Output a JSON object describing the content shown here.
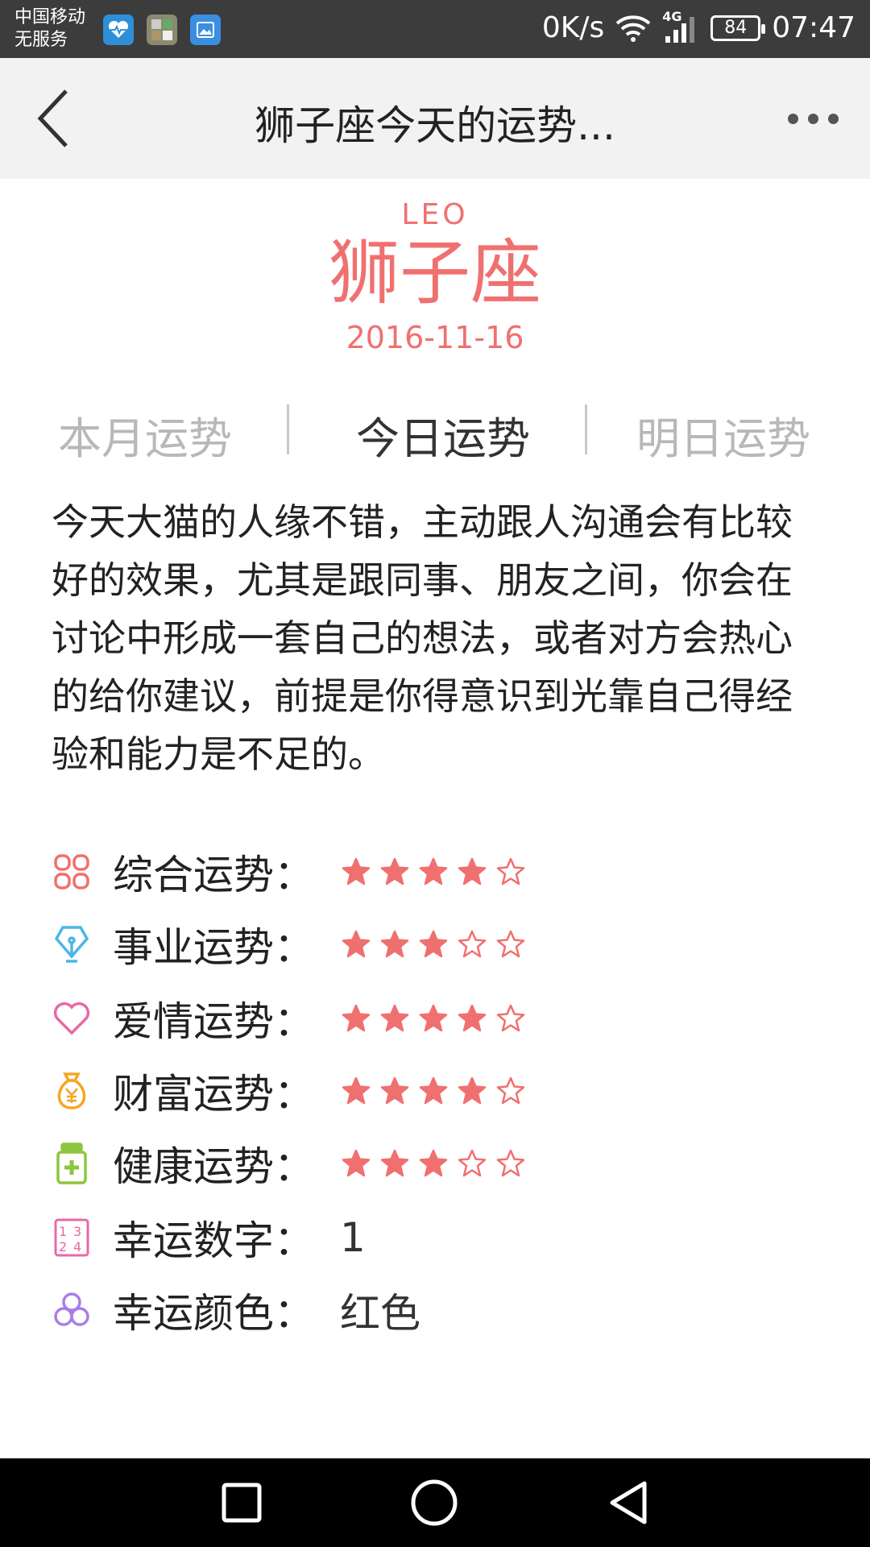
{
  "status_bar": {
    "carrier_line1": "中国移动",
    "carrier_line2": "无服务",
    "net_speed": "0K/s",
    "network_type": "4G",
    "battery": "84",
    "time": "07:47"
  },
  "app_bar": {
    "title": "狮子座今天的运势..."
  },
  "header": {
    "sign_latin": "LEO",
    "sign_name": "狮子座",
    "date": "2016-11-16",
    "accent_color": "#f07070"
  },
  "tabs": [
    {
      "label": "本月运势",
      "active": false
    },
    {
      "label": "今日运势",
      "active": true
    },
    {
      "label": "明日运势",
      "active": false
    }
  ],
  "description": "今天大猫的人缘不错，主动跟人沟通会有比较好的效果，尤其是跟同事、朋友之间，你会在讨论中形成一套自己的想法，或者对方会热心的给你建议，前提是你得意识到光靠自己得经验和能力是不足的。",
  "fortunes": [
    {
      "label": "综合运势：",
      "icon": "clover-icon",
      "icon_color": "#f07070",
      "stars": 4,
      "max": 5
    },
    {
      "label": "事业运势：",
      "icon": "pen-nib-icon",
      "icon_color": "#4ab6e8",
      "stars": 3,
      "max": 5
    },
    {
      "label": "爱情运势：",
      "icon": "heart-icon",
      "icon_color": "#e868a8",
      "stars": 4,
      "max": 5
    },
    {
      "label": "财富运势：",
      "icon": "money-bag-icon",
      "icon_color": "#f5a623",
      "stars": 4,
      "max": 5
    },
    {
      "label": "健康运势：",
      "icon": "medicine-bottle-icon",
      "icon_color": "#8cc63e",
      "stars": 3,
      "max": 5
    }
  ],
  "lucky": [
    {
      "label": "幸运数字：",
      "value": "1",
      "icon": "number-grid-icon",
      "icon_color": "#e868a8"
    },
    {
      "label": "幸运颜色：",
      "value": "红色",
      "icon": "color-circles-icon",
      "icon_color": "#a67ee8"
    }
  ],
  "star_color": "#f07070"
}
